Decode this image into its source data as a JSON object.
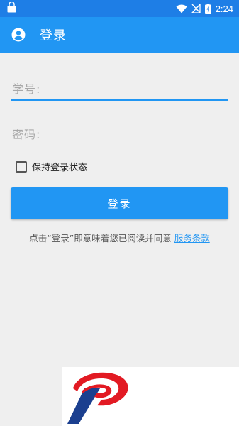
{
  "status_bar": {
    "time": "2:24",
    "icons": [
      "shopping-bag-icon",
      "wifi-icon",
      "signal-off-icon",
      "battery-charging-icon"
    ]
  },
  "app_bar": {
    "title": "登录",
    "icon": "account-circle-icon"
  },
  "form": {
    "username_label": "学号:",
    "password_label": "密码:",
    "remember_label": "保持登录状态",
    "remember_checked": false,
    "login_button": "登录"
  },
  "terms": {
    "prefix": "点击“登录”即意味着您已阅读并同意 ",
    "link": "服务条款"
  },
  "banner": {
    "logo": "red-blue-p-logo"
  },
  "colors": {
    "primary": "#2196f3",
    "status_bar": "#1e7ee6",
    "background": "#efefef"
  }
}
